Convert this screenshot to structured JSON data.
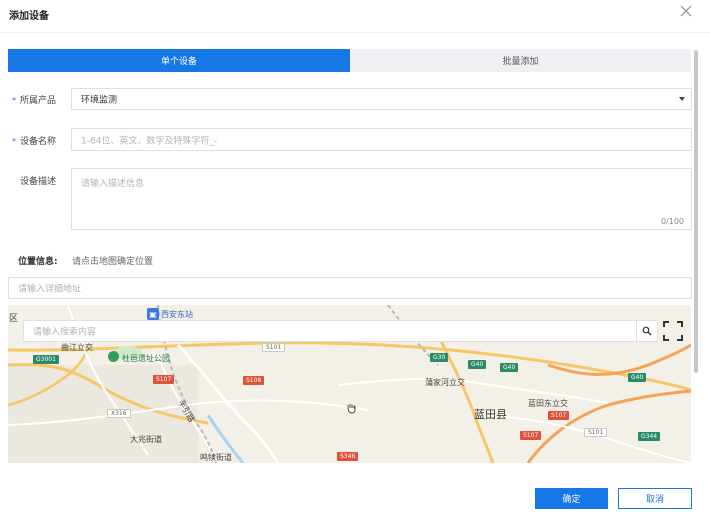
{
  "dialog": {
    "title": "添加设备"
  },
  "tabs": [
    {
      "label": "单个设备",
      "active": true
    },
    {
      "label": "批量添加",
      "active": false
    }
  ],
  "form": {
    "product": {
      "label": "所属产品",
      "value": "环境监测",
      "required": true
    },
    "device_name": {
      "label": "设备名称",
      "placeholder": "1-64位、英文、数字及特殊字符_-",
      "required": true
    },
    "description": {
      "label": "设备描述",
      "placeholder": "请输入描述信息",
      "counter": "0/100"
    }
  },
  "location": {
    "label": "位置信息:",
    "hint": "请点击地图确定位置",
    "address_placeholder": "请输入详细地址"
  },
  "map": {
    "search_placeholder": "请输入搜索内容",
    "labels": {
      "district": "区",
      "station": "西安东站",
      "park": "杜邑遗址公园",
      "qujiang": "曲江立交",
      "bayin": "半引路",
      "dazhao": "大兆街道",
      "mingdu": "鸣犊街道",
      "pujia": "蒲家河立交",
      "lantian": "蓝田县",
      "landong": "蓝田东立交"
    },
    "shields": [
      "G3001",
      "S101",
      "G30",
      "S107",
      "S108",
      "X316",
      "G40",
      "G40",
      "S107",
      "G40",
      "S101",
      "S107",
      "G344",
      "S346"
    ]
  },
  "actions": {
    "confirm": "确定",
    "cancel": "取消"
  },
  "colors": {
    "primary": "#1677e6",
    "required": "#2f6fe0"
  }
}
